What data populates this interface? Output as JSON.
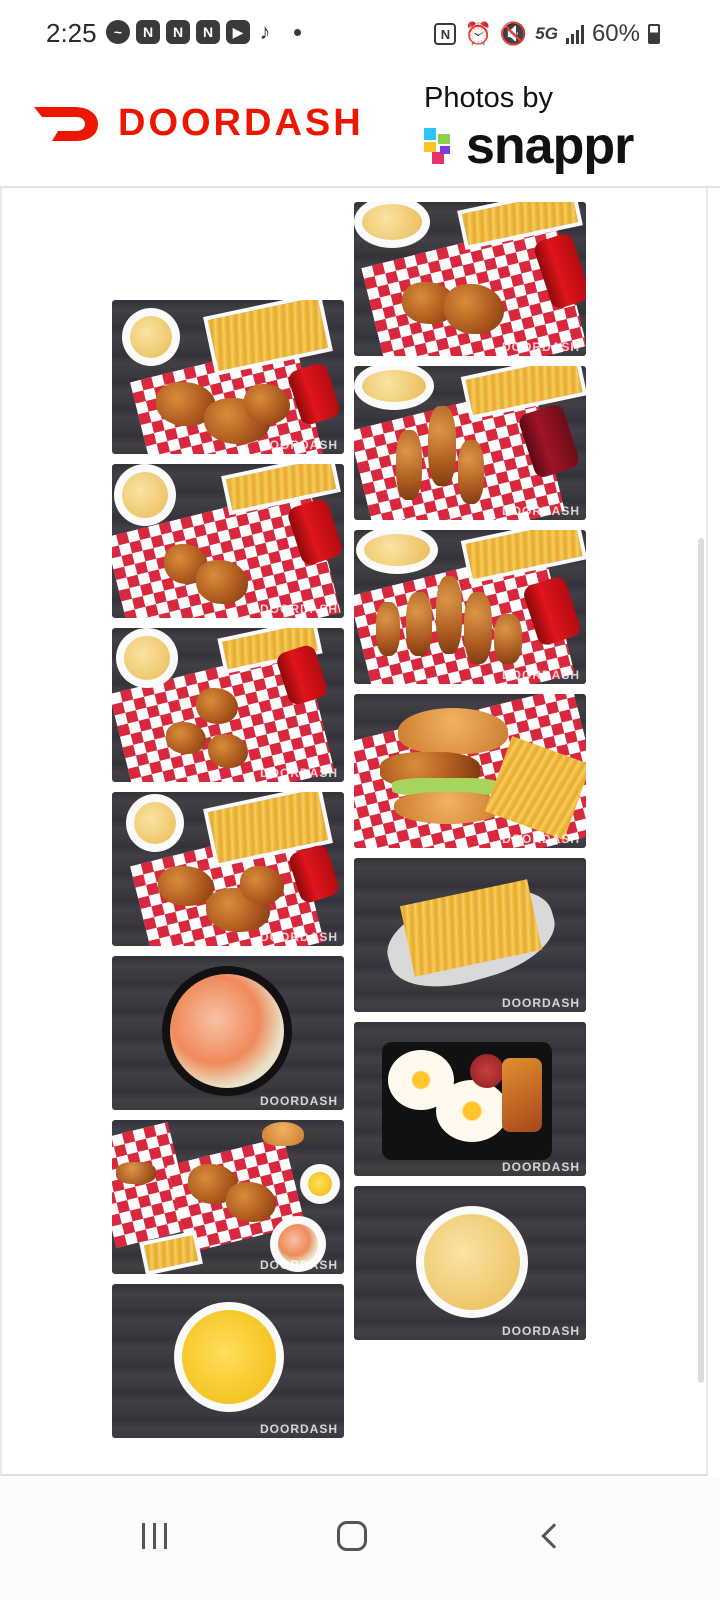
{
  "status_bar": {
    "time": "2:25",
    "notifications": [
      "messenger-icon",
      "app-n-icon",
      "app-n-icon",
      "app-n-icon",
      "youtube-icon",
      "tiktok-icon",
      "dot-icon"
    ],
    "network": "5G",
    "battery_percent": "60%"
  },
  "header": {
    "brand": "DOORDASH",
    "photos_by": "Photos by",
    "partner": "snappr",
    "brand_color": "#EB1700"
  },
  "gallery": {
    "watermark": "DOORDASH",
    "left_column": [
      {
        "name": "fried-chicken-combo-photo",
        "dish": "chicken-fries-yuca-coke"
      },
      {
        "name": "chicken-quarter-combo-photo",
        "dish": "chicken-fries-yuca-coke"
      },
      {
        "name": "chicken-pieces-combo-photo",
        "dish": "chicken-fries-yuca-coke"
      },
      {
        "name": "chicken-wings-combo-photo",
        "dish": "chicken-fries-yuca-coke"
      },
      {
        "name": "salad-bowl-photo",
        "dish": "salad"
      },
      {
        "name": "family-platter-photo",
        "dish": "platter"
      },
      {
        "name": "tostones-bowl-photo",
        "dish": "tostones"
      }
    ],
    "right_column": [
      {
        "name": "chicken-drumsticks-combo-photo",
        "dish": "chicken-fries-yuca-coke"
      },
      {
        "name": "chicken-tenders-drpepper-photo",
        "dish": "tenders-fries-yuca-drpepper"
      },
      {
        "name": "chicken-tenders-coke-photo",
        "dish": "tenders-fries-yuca-coke"
      },
      {
        "name": "chicken-sandwich-photo",
        "dish": "sandwich-fries"
      },
      {
        "name": "french-fries-tray-photo",
        "dish": "fries"
      },
      {
        "name": "breakfast-plate-photo",
        "dish": "eggs-salami-fried-cheese"
      },
      {
        "name": "yuca-fries-bowl-photo",
        "dish": "yuca"
      }
    ]
  },
  "navbar": {
    "buttons": [
      "recents-icon",
      "home-icon",
      "back-icon"
    ]
  }
}
